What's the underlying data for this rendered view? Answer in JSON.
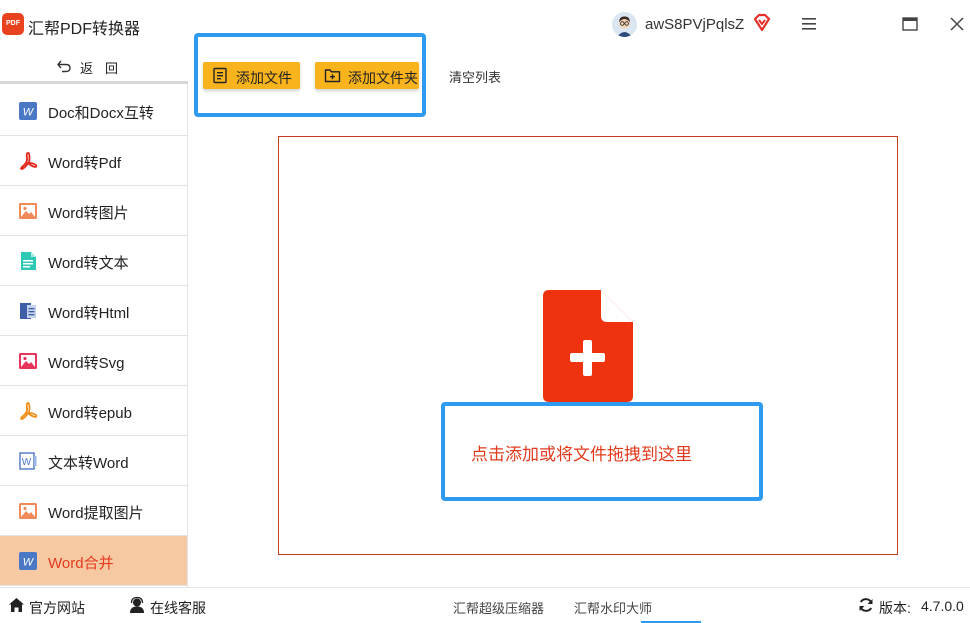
{
  "titlebar": {
    "logo_text": "PDF",
    "title": "汇帮PDF转换器",
    "username": "awS8PVjPqlsZ"
  },
  "sidebar": {
    "back_label": "返回",
    "items": [
      {
        "label": "Doc和Docx互转",
        "icon": "word-icon"
      },
      {
        "label": "Word转Pdf",
        "icon": "pdf-icon"
      },
      {
        "label": "Word转图片",
        "icon": "image-icon"
      },
      {
        "label": "Word转文本",
        "icon": "text-file-icon"
      },
      {
        "label": "Word转Html",
        "icon": "html-icon"
      },
      {
        "label": "Word转Svg",
        "icon": "svg-image-icon"
      },
      {
        "label": "Word转epub",
        "icon": "epub-icon"
      },
      {
        "label": "文本转Word",
        "icon": "word-outline-icon"
      },
      {
        "label": "Word提取图片",
        "icon": "image-icon"
      },
      {
        "label": "Word合并",
        "icon": "word-icon",
        "active": true
      }
    ]
  },
  "toolbar": {
    "add_file": "添加文件",
    "add_folder": "添加文件夹",
    "clear_list": "清空列表"
  },
  "dropzone": {
    "hint": "点击添加或将文件拖拽到这里"
  },
  "statusbar": {
    "official_site": "官方网站",
    "online_support": "在线客服",
    "tabs": [
      "汇帮超级压缩器",
      "汇帮水印大师"
    ],
    "version_label": "版本:",
    "version_value": "4.7.0.0"
  },
  "colors": {
    "accent_orange": "#f9b41d",
    "active_bg": "#f7c9a3",
    "active_text": "#e53a1e",
    "highlight_blue": "#2f9bf0",
    "file_icon_red": "#f0330f"
  }
}
